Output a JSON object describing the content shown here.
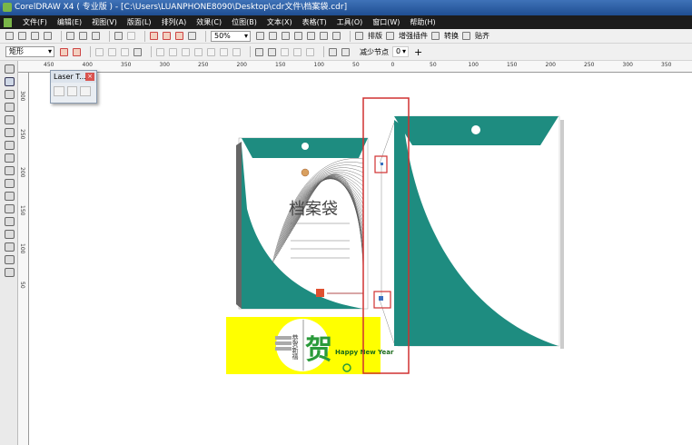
{
  "window": {
    "title": "CorelDRAW X4 ( 专业版 ) - [C:\\Users\\LUANPHONE8090\\Desktop\\cdr文件\\档案袋.cdr]"
  },
  "menu": [
    "文件(F)",
    "编辑(E)",
    "视图(V)",
    "版面(L)",
    "排列(A)",
    "效果(C)",
    "位图(B)",
    "文本(X)",
    "表格(T)",
    "工具(O)",
    "窗口(W)",
    "帮助(H)"
  ],
  "toolbar": {
    "zoom": "50%",
    "plugins": [
      "排版",
      "增强插件",
      "转换",
      "贴齐"
    ]
  },
  "propertybar": {
    "shape": "矩形",
    "reduce_nodes_label": "减少节点",
    "reduce_nodes_value": "0"
  },
  "ruler": {
    "h_labels": [
      "450",
      "400",
      "350",
      "300",
      "250",
      "200",
      "150",
      "100",
      "50",
      "0",
      "50",
      "100",
      "150",
      "200",
      "250",
      "300",
      "350"
    ],
    "v_labels": [
      "300",
      "250",
      "200",
      "150",
      "100",
      "50"
    ]
  },
  "laser_panel": {
    "title": "Laser T...",
    "close": "×"
  },
  "artwork": {
    "title": "档案袋",
    "card_greeting": "Happy New Year",
    "card_char": "贺",
    "card_side": "恭贺新禧",
    "colors": {
      "teal": "#1e8c80",
      "yellow": "#ffff00",
      "green": "#2a9a3a",
      "red_box": "#d03030"
    }
  }
}
